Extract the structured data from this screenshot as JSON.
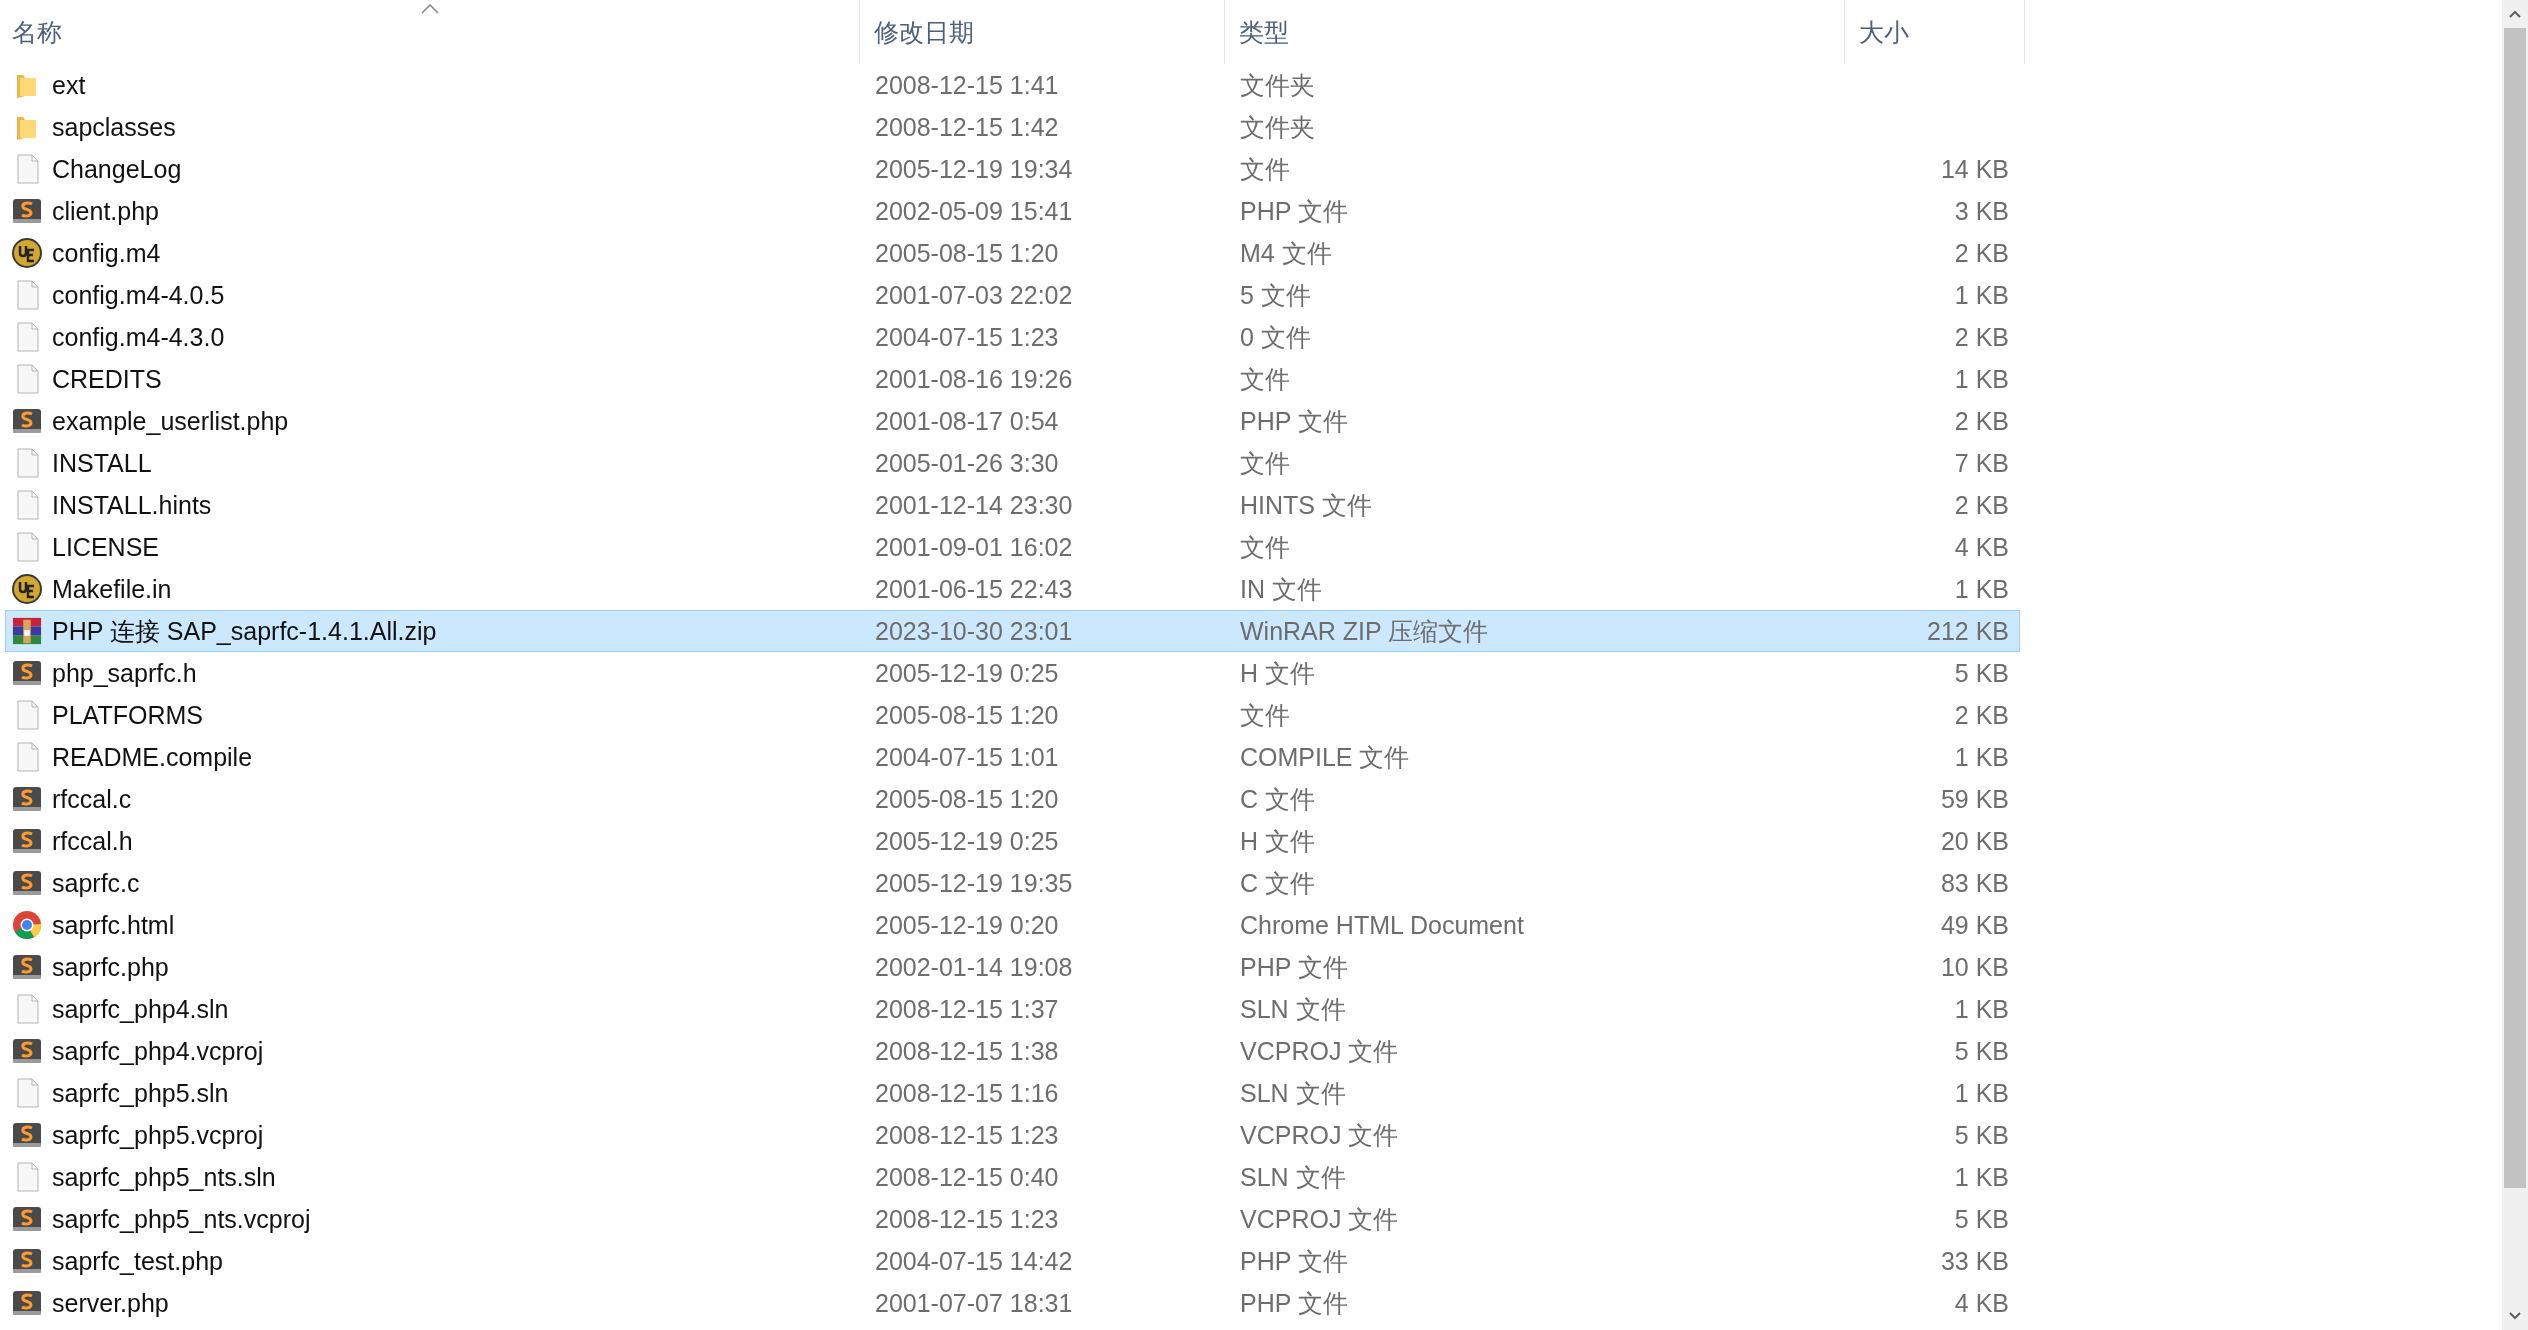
{
  "columns": [
    {
      "label": "名称",
      "sorted": true
    },
    {
      "label": "修改日期",
      "sorted": false
    },
    {
      "label": "类型",
      "sorted": false
    },
    {
      "label": "大小",
      "sorted": false
    }
  ],
  "files": [
    {
      "name": "ext",
      "date": "2008-12-15 1:41",
      "type": "文件夹",
      "kind": "folder",
      "selected": false
    },
    {
      "name": "sapclasses",
      "date": "2008-12-15 1:42",
      "type": "文件夹",
      "kind": "folder",
      "selected": false
    },
    {
      "name": "ChangeLog",
      "date": "2005-12-19 19:34",
      "type": "文件",
      "size": "14 KB",
      "kind": "file",
      "selected": false
    },
    {
      "name": "client.php",
      "date": "2002-05-09 15:41",
      "type": "PHP 文件",
      "size": "3 KB",
      "kind": "sublime",
      "selected": false
    },
    {
      "name": "config.m4",
      "date": "2005-08-15 1:20",
      "type": "M4 文件",
      "size": "2 KB",
      "kind": "ue",
      "selected": false
    },
    {
      "name": "config.m4-4.0.5",
      "date": "2001-07-03 22:02",
      "type": "5 文件",
      "size": "1 KB",
      "kind": "file",
      "selected": false
    },
    {
      "name": "config.m4-4.3.0",
      "date": "2004-07-15 1:23",
      "type": "0 文件",
      "size": "2 KB",
      "kind": "file",
      "selected": false
    },
    {
      "name": "CREDITS",
      "date": "2001-08-16 19:26",
      "type": "文件",
      "size": "1 KB",
      "kind": "file",
      "selected": false
    },
    {
      "name": "example_userlist.php",
      "date": "2001-08-17 0:54",
      "type": "PHP 文件",
      "size": "2 KB",
      "kind": "sublime",
      "selected": false
    },
    {
      "name": "INSTALL",
      "date": "2005-01-26 3:30",
      "type": "文件",
      "size": "7 KB",
      "kind": "file",
      "selected": false
    },
    {
      "name": "INSTALL.hints",
      "date": "2001-12-14 23:30",
      "type": "HINTS 文件",
      "size": "2 KB",
      "kind": "file",
      "selected": false
    },
    {
      "name": "LICENSE",
      "date": "2001-09-01 16:02",
      "type": "文件",
      "size": "4 KB",
      "kind": "file",
      "selected": false
    },
    {
      "name": "Makefile.in",
      "date": "2001-06-15 22:43",
      "type": "IN 文件",
      "size": "1 KB",
      "kind": "ue",
      "selected": false
    },
    {
      "name": "PHP 连接 SAP_saprfc-1.4.1.All.zip",
      "date": "2023-10-30 23:01",
      "type": "WinRAR ZIP 压缩文件",
      "size": "212 KB",
      "kind": "winrar",
      "selected": true
    },
    {
      "name": "php_saprfc.h",
      "date": "2005-12-19 0:25",
      "type": "H 文件",
      "size": "5 KB",
      "kind": "sublime",
      "selected": false
    },
    {
      "name": "PLATFORMS",
      "date": "2005-08-15 1:20",
      "type": "文件",
      "size": "2 KB",
      "kind": "file",
      "selected": false
    },
    {
      "name": "README.compile",
      "date": "2004-07-15 1:01",
      "type": "COMPILE 文件",
      "size": "1 KB",
      "kind": "file",
      "selected": false
    },
    {
      "name": "rfccal.c",
      "date": "2005-08-15 1:20",
      "type": "C 文件",
      "size": "59 KB",
      "kind": "sublime",
      "selected": false
    },
    {
      "name": "rfccal.h",
      "date": "2005-12-19 0:25",
      "type": "H 文件",
      "size": "20 KB",
      "kind": "sublime",
      "selected": false
    },
    {
      "name": "saprfc.c",
      "date": "2005-12-19 19:35",
      "type": "C 文件",
      "size": "83 KB",
      "kind": "sublime",
      "selected": false
    },
    {
      "name": "saprfc.html",
      "date": "2005-12-19 0:20",
      "type": "Chrome HTML Document",
      "size": "49 KB",
      "kind": "chrome",
      "selected": false
    },
    {
      "name": "saprfc.php",
      "date": "2002-01-14 19:08",
      "type": "PHP 文件",
      "size": "10 KB",
      "kind": "sublime",
      "selected": false
    },
    {
      "name": "saprfc_php4.sln",
      "date": "2008-12-15 1:37",
      "type": "SLN 文件",
      "size": "1 KB",
      "kind": "file",
      "selected": false
    },
    {
      "name": "saprfc_php4.vcproj",
      "date": "2008-12-15 1:38",
      "type": "VCPROJ 文件",
      "size": "5 KB",
      "kind": "sublime",
      "selected": false
    },
    {
      "name": "saprfc_php5.sln",
      "date": "2008-12-15 1:16",
      "type": "SLN 文件",
      "size": "1 KB",
      "kind": "file",
      "selected": false
    },
    {
      "name": "saprfc_php5.vcproj",
      "date": "2008-12-15 1:23",
      "type": "VCPROJ 文件",
      "size": "5 KB",
      "kind": "sublime",
      "selected": false
    },
    {
      "name": "saprfc_php5_nts.sln",
      "date": "2008-12-15 0:40",
      "type": "SLN 文件",
      "size": "1 KB",
      "kind": "file",
      "selected": false
    },
    {
      "name": "saprfc_php5_nts.vcproj",
      "date": "2008-12-15 1:23",
      "type": "VCPROJ 文件",
      "size": "5 KB",
      "kind": "sublime",
      "selected": false
    },
    {
      "name": "saprfc_test.php",
      "date": "2004-07-15 14:42",
      "type": "PHP 文件",
      "size": "33 KB",
      "kind": "sublime",
      "selected": false
    },
    {
      "name": "server.php",
      "date": "2001-07-07 18:31",
      "type": "PHP 文件",
      "size": "4 KB",
      "kind": "sublime",
      "selected": false
    }
  ]
}
